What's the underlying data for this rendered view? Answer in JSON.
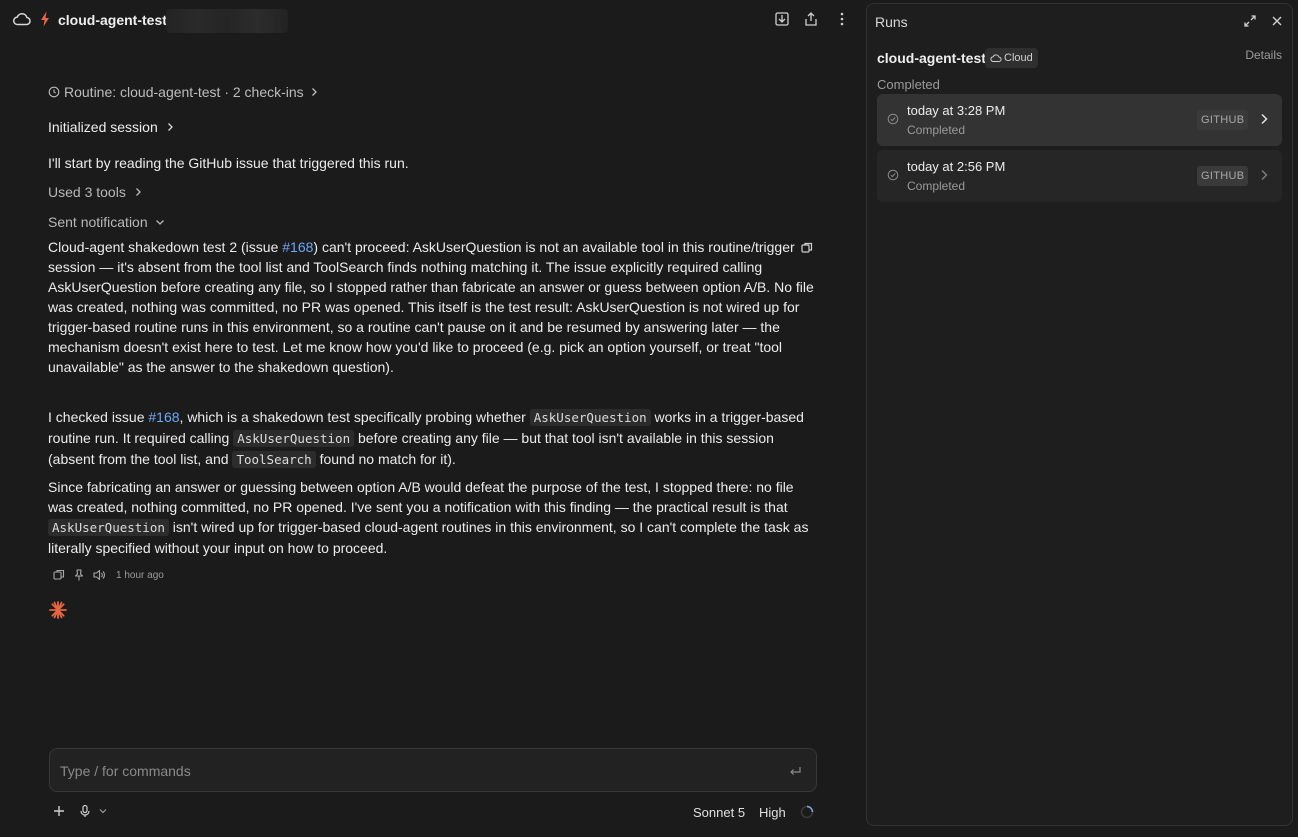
{
  "header": {
    "session_title": "cloud-agent-test",
    "icons": [
      "cloud-icon",
      "bolt-icon",
      "save-icon",
      "share-icon",
      "more-vertical-icon"
    ]
  },
  "conversation": {
    "routine_line": "Routine: cloud-agent-test · 2 check-ins",
    "initialized_session": "Initialized session",
    "intro": "I'll start by reading the GitHub issue that triggered this run.",
    "used_tools": "Used 3 tools",
    "sent_notification": "Sent notification",
    "notification": {
      "p1": "Cloud-agent shakedown test 2 (issue ",
      "issue_link": "#168",
      "p2": ") can't proceed: AskUserQuestion is not an available tool in this routine/trigger session — it's absent from the tool list and ToolSearch finds nothing matching it. The issue explicitly required calling AskUserQuestion before creating any file, so I stopped rather than fabricate an answer or guess between option A/B. No file was created, nothing was committed, no PR was opened. This itself is the test result: AskUserQuestion is not wired up for trigger-based routine runs in this environment, so a routine can't pause on it and be resumed by answering later — the mechanism doesn't exist here to test. Let me know how you'd like to proceed (e.g. pick an option yourself, or treat \"tool unavailable\" as the answer to the shakedown question)."
    },
    "checked": {
      "a": "I checked issue ",
      "link": "#168",
      "b": ", which is a shakedown test specifically probing whether ",
      "code1": "AskUserQuestion",
      "c": " works in a trigger-based routine run. It required calling ",
      "code2": "AskUserQuestion",
      "d": " before creating any file — but that tool isn't available in this session (absent from the tool list, and ",
      "code3": "ToolSearch",
      "e": " found no match for it)."
    },
    "conclusion": {
      "a": "Since fabricating an answer or guessing between option A/B would defeat the purpose of the test, I stopped there: no file was created, nothing committed, no PR opened. I've sent you a notification with this finding — the practical result is that ",
      "code1": "AskUserQuestion",
      "b": " isn't wired up for trigger-based cloud-agent routines in this environment, so I can't complete the task as literally specified without your input on how to proceed."
    },
    "timestamp": "1 hour ago"
  },
  "composer": {
    "placeholder": "Type / for commands",
    "model": "Sonnet 5",
    "effort": "High"
  },
  "runs_panel": {
    "title": "Runs",
    "routine_name": "cloud-agent-test",
    "badge": "Cloud",
    "details": "Details",
    "status": "Completed",
    "runs": [
      {
        "time": "today at 3:28 PM",
        "status": "Completed",
        "source": "GITHUB",
        "selected": true
      },
      {
        "time": "today at 2:56 PM",
        "status": "Completed",
        "source": "GITHUB",
        "selected": false
      }
    ]
  },
  "colors": {
    "background": "#1b1b1b",
    "panel": "#1e1e1e",
    "link": "#6ea8f7",
    "accent_orange": "#e8663d"
  }
}
